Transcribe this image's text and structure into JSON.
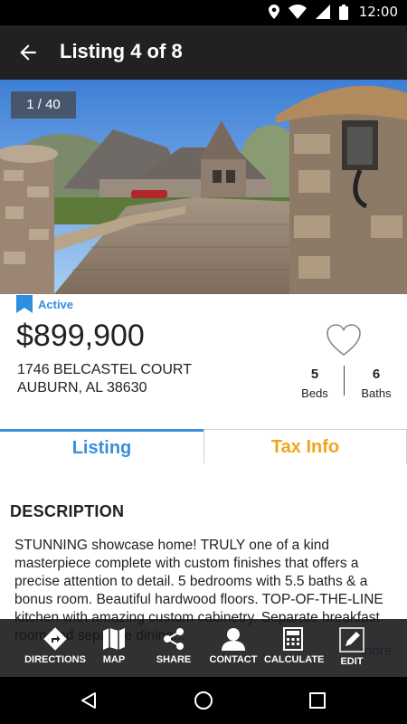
{
  "status_bar": {
    "time": "12:00"
  },
  "app_bar": {
    "title": "Listing 4 of 8"
  },
  "hero": {
    "photo_count": "1 / 40"
  },
  "listing": {
    "status": "Active",
    "price": "$899,900",
    "address_line1": "1746 BELCASTEL COURT",
    "address_line2": "AUBURN, AL 38630",
    "beds": "5",
    "beds_label": "Beds",
    "baths": "6",
    "baths_label": "Baths"
  },
  "tabs": [
    {
      "label": "Listing",
      "selected": true
    },
    {
      "label": "Tax Info",
      "selected": false
    }
  ],
  "description": {
    "title": "DESCRIPTION",
    "text": "STUNNING showcase home! TRULY one of a kind masterpiece complete with custom finishes that offers a precise attention to detail. 5 bedrooms with 5.5 baths & a bonus room. Beautiful hardwood floors. TOP-OF-THE-LINE kitchen with amazing custom cabinetry. Separate breakfast room and separate dining...",
    "more_label": "more"
  },
  "toolbar": {
    "directions": "DIRECTIONS",
    "map": "MAP",
    "share": "SHARE",
    "contact": "CONTACT",
    "calculate": "CALCULATE",
    "edit": "EDIT"
  },
  "colors": {
    "accent_blue": "#3a8edc",
    "tax_orange": "#f2a51a",
    "app_bar": "#212121"
  }
}
